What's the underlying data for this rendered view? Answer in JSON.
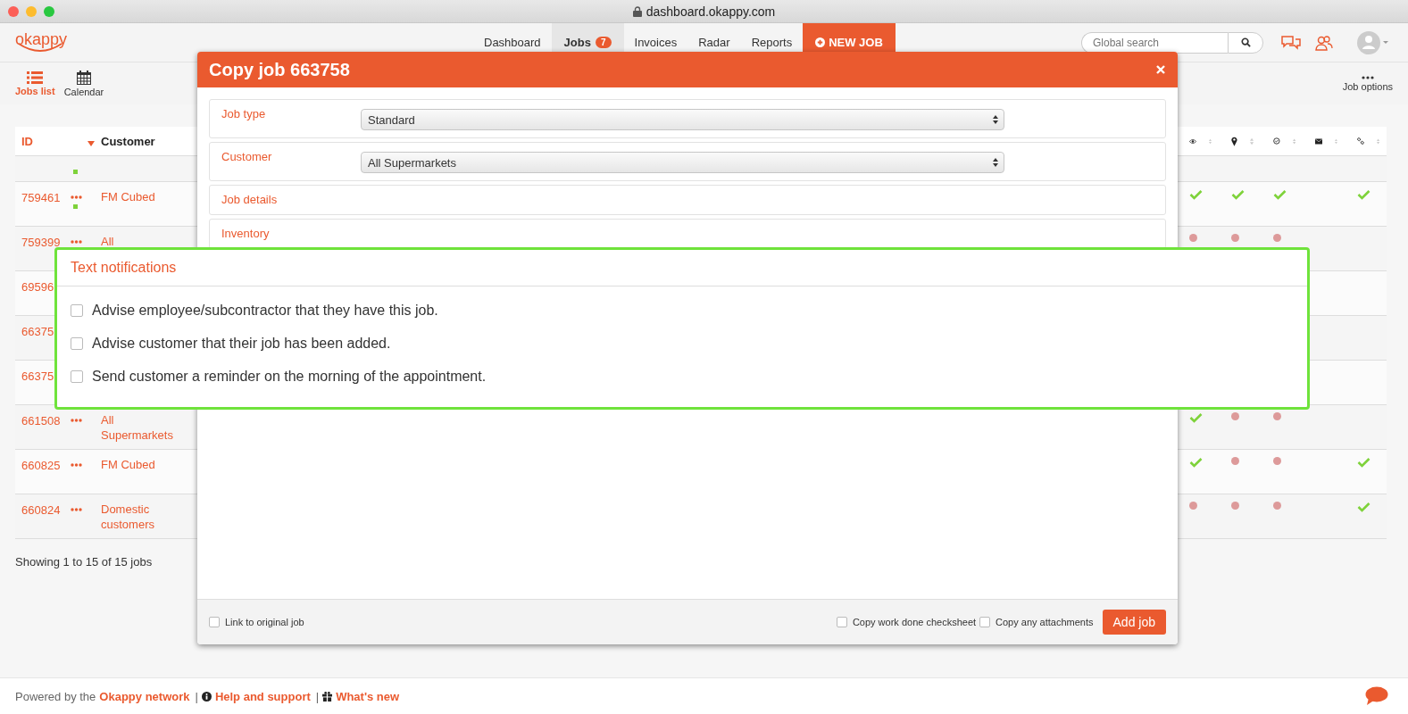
{
  "window": {
    "title": "dashboard.okappy.com"
  },
  "nav": {
    "logo": "okappy",
    "items": [
      {
        "label": "Dashboard",
        "selected": false
      },
      {
        "label": "Jobs",
        "badge": "7",
        "selected": true
      },
      {
        "label": "Invoices",
        "selected": false
      },
      {
        "label": "Radar",
        "selected": false
      },
      {
        "label": "Reports",
        "selected": false
      }
    ],
    "new_job": "NEW JOB",
    "search": {
      "placeholder": "Global search"
    }
  },
  "views": [
    {
      "label": "Jobs list",
      "selected": true
    },
    {
      "label": "Calendar",
      "selected": false
    }
  ],
  "job_options": "Job options",
  "table": {
    "columns": [
      "ID",
      "Customer"
    ],
    "rows": [
      {
        "flag": true
      },
      {
        "id": "759461",
        "menu": true,
        "customer": "FM Cubed",
        "flag": true,
        "status": [
          {
            "kind": "check"
          },
          {
            "kind": "check"
          },
          {
            "kind": "check"
          },
          {
            "kind": "blank"
          },
          {
            "kind": "check"
          }
        ]
      },
      {
        "id": "759399",
        "menu": true,
        "customer": "All",
        "flag": false,
        "status": [
          {
            "kind": "dot"
          },
          {
            "kind": "dot"
          },
          {
            "kind": "dot"
          }
        ]
      },
      {
        "id": "69596"
      },
      {
        "id": "66375"
      },
      {
        "id": "66375"
      },
      {
        "id": "661508",
        "menu": true,
        "customer": "All Supermarkets",
        "flag": false,
        "status": [
          {
            "kind": "check"
          },
          {
            "kind": "dot"
          },
          {
            "kind": "dot"
          }
        ]
      },
      {
        "id": "660825",
        "menu": true,
        "customer": "FM Cubed",
        "flag": false,
        "status": [
          {
            "kind": "check"
          },
          {
            "kind": "dot"
          },
          {
            "kind": "dot"
          },
          {
            "kind": "blank"
          },
          {
            "kind": "check"
          }
        ]
      },
      {
        "id": "660824",
        "menu": true,
        "customer": "Domestic customers",
        "flag": false,
        "status": [
          {
            "kind": "dot"
          },
          {
            "kind": "dot"
          },
          {
            "kind": "dot"
          },
          {
            "kind": "blank"
          },
          {
            "kind": "check"
          }
        ]
      }
    ],
    "summary": "Showing 1 to 15 of 15 jobs"
  },
  "modal": {
    "title": "Copy job 663758",
    "sections": [
      {
        "label": "Job type",
        "kind": "select",
        "value": "Standard"
      },
      {
        "label": "Customer",
        "kind": "select",
        "value": "All Supermarkets"
      },
      {
        "label": "Job details",
        "kind": "heading"
      },
      {
        "label": "Inventory",
        "kind": "heading"
      }
    ],
    "footer_left": {
      "label": "Link to original job",
      "checked": false
    },
    "footer_right": [
      {
        "label": "Copy work done checksheet",
        "checked": false
      },
      {
        "label": "Copy any attachments",
        "checked": false
      }
    ],
    "submit": "Add job"
  },
  "notifications": {
    "title": "Text notifications",
    "options": [
      {
        "label": "Advise employee/subcontractor that they have this job.",
        "checked": false
      },
      {
        "label": "Advise customer that their job has been added.",
        "checked": false
      },
      {
        "label": "Send customer a reminder on the morning of the appointment.",
        "checked": false
      }
    ]
  },
  "footer": [
    {
      "kind": "text",
      "text": "Powered by the"
    },
    {
      "kind": "link",
      "text": "Okappy network"
    },
    {
      "kind": "sep",
      "text": "|"
    },
    {
      "kind": "link",
      "text": "Help and support"
    },
    {
      "kind": "sep",
      "text": "|"
    },
    {
      "kind": "link",
      "text": "What's new"
    }
  ]
}
